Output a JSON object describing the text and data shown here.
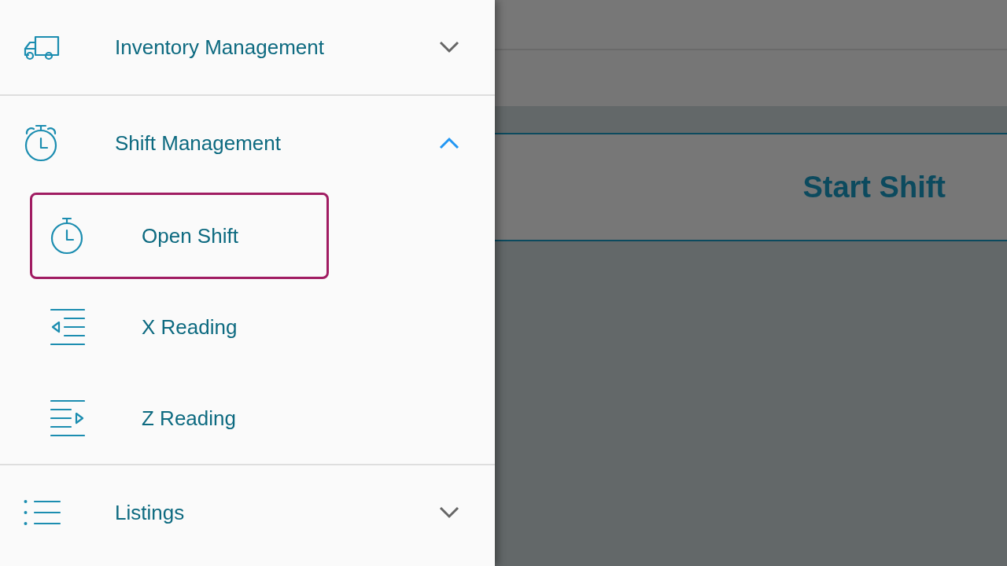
{
  "sidebar": {
    "groups": [
      {
        "label": "Inventory Management",
        "expanded": false
      },
      {
        "label": "Shift Management",
        "expanded": true,
        "children": [
          {
            "label": "Open Shift",
            "selected": true
          },
          {
            "label": "X Reading",
            "selected": false
          },
          {
            "label": "Z Reading",
            "selected": false
          }
        ]
      },
      {
        "label": "Listings",
        "expanded": false
      }
    ]
  },
  "page": {
    "title": "Start Shift"
  }
}
